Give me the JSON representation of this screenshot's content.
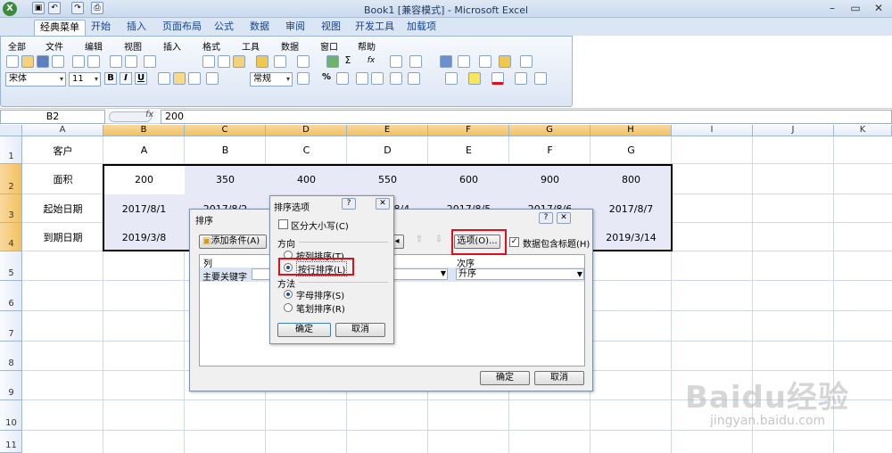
{
  "window": {
    "title": "Book1 [兼容模式] - Microsoft Excel"
  },
  "ribbon_tabs": [
    "经典菜单",
    "开始",
    "插入",
    "页面布局",
    "公式",
    "数据",
    "审阅",
    "视图",
    "开发工具",
    "加载项"
  ],
  "classic_menu": [
    "全部",
    "文件",
    "编辑",
    "视图",
    "插入",
    "格式",
    "工具",
    "数据",
    "窗口",
    "帮助"
  ],
  "format_toolbar": {
    "font": "宋体",
    "size": "11",
    "bold": "B",
    "italic": "I",
    "underline": "U",
    "number_format": "常规",
    "percent": "%"
  },
  "formula_bar": {
    "name_box": "B2",
    "fx": "fx",
    "value": "200"
  },
  "columns": [
    "A",
    "B",
    "C",
    "D",
    "E",
    "F",
    "G",
    "H",
    "I",
    "J",
    "K"
  ],
  "rows": [
    "1",
    "2",
    "3",
    "4",
    "5",
    "6",
    "7",
    "8",
    "9",
    "10",
    "11"
  ],
  "sheet": {
    "row1": [
      "客户",
      "A",
      "B",
      "C",
      "D",
      "E",
      "F",
      "G"
    ],
    "row2": [
      "面积",
      "200",
      "350",
      "400",
      "550",
      "600",
      "900",
      "800"
    ],
    "row3": [
      "起始日期",
      "2017/8/1",
      "2017/8/2",
      "",
      "2017/8/4",
      "2017/8/5",
      "2017/8/6",
      "2017/8/7"
    ],
    "row4": [
      "到期日期",
      "2019/3/8",
      "",
      "",
      "",
      "",
      "",
      "2019/3/14"
    ]
  },
  "sort_dialog": {
    "title": "排序",
    "add_condition": "添加条件(A)",
    "options_button": "选项(O)...",
    "has_header": "数据包含标题(H)",
    "col_header": "列",
    "order_header": "次序",
    "primary_key": "主要关键字",
    "order_value": "升序",
    "ok": "确定",
    "cancel": "取消",
    "question": "?",
    "close": "✕"
  },
  "sort_options_dialog": {
    "title": "排序选项",
    "case_sensitive": "区分大小写(C)",
    "direction_label": "方向",
    "by_column": "按列排序(T)",
    "by_row": "按行排序(L)",
    "method_label": "方法",
    "alpha": "字母排序(S)",
    "stroke": "笔划排序(R)",
    "ok": "确定",
    "cancel": "取消",
    "question": "?",
    "close": "✕"
  },
  "watermark": {
    "brand": "Baidu经验",
    "url": "jingyan.baidu.com"
  },
  "colors": {
    "selected_header": "#f1c15f",
    "highlight_row": "#e7e9f7",
    "red_box": "#e0101a"
  }
}
